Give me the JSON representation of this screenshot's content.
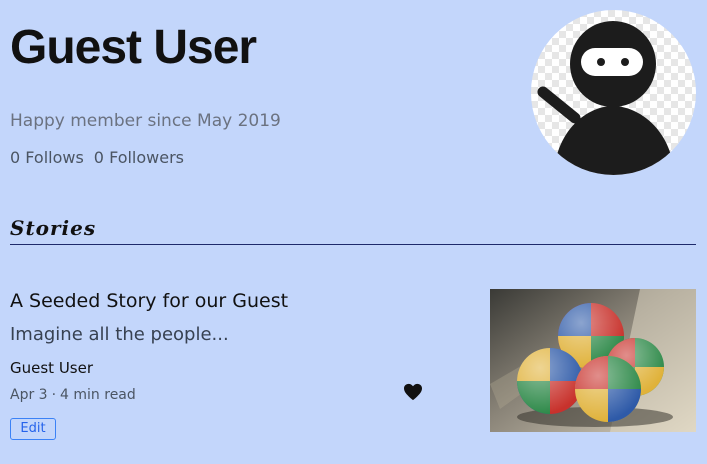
{
  "profile": {
    "name": "Guest User",
    "member_since": "Happy member since May 2019",
    "follows": "0 Follows",
    "followers": "0 Followers",
    "avatar_icon": "ninja-avatar-icon"
  },
  "stories_section": {
    "title": "Stories"
  },
  "stories": [
    {
      "title": "A Seeded Story for our Guest",
      "subtitle": "Imagine all the people...",
      "author": "Guest User",
      "date": "Apr 3",
      "separator": "·",
      "read_time": "4 min read",
      "like_icon": "heart-icon",
      "edit_label": "Edit",
      "image_icon": "juggling-balls-image"
    }
  ],
  "colors": {
    "background": "#c3d6fb",
    "accent": "#2563eb",
    "divider": "#1e2a6b"
  }
}
